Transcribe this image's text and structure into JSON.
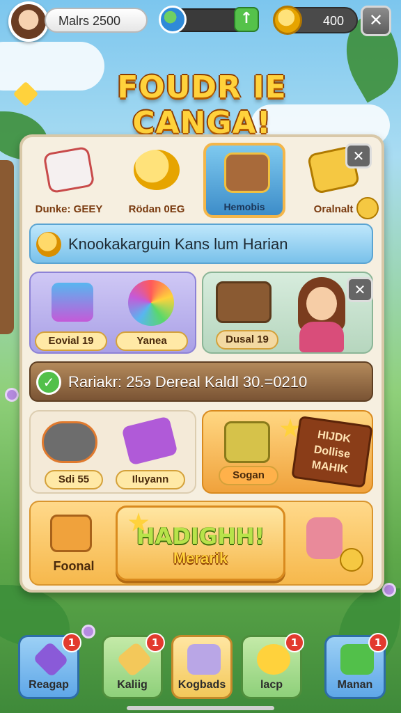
{
  "header": {
    "player_name": "Malrs 2500",
    "coins": "400",
    "title": "FOUDR IE CANGA!"
  },
  "categories": [
    {
      "label": "Dunke: GEEY",
      "icon": "card-icon"
    },
    {
      "label": "Rödan 0EG",
      "icon": "coin-bag-icon"
    },
    {
      "label": "Hemobis",
      "icon": "chest-icon",
      "selected": true
    },
    {
      "label": "Oralnalt",
      "icon": "ticket-icon"
    }
  ],
  "info_banner": "Knookakarguin Kans lum Harian",
  "items_row1": {
    "tag_left": "Eovial 19",
    "tag_right": "Yanea",
    "chest_tag": "Dusal 19"
  },
  "status_banner": "Rariakr: 25э Dereal Kaldl 30.=0210",
  "items_row2": {
    "tag_left": "Sdi 55",
    "tag_right": "Iluyann",
    "shop_tag": "Sogan",
    "sign_lines": [
      "HIJDK",
      "Dollise",
      "MAHIK"
    ]
  },
  "featured": {
    "left_label": "Foonal",
    "button_line1": "HADIGHH!",
    "button_line2": "Merarik"
  },
  "nav": [
    {
      "label": "Reagap",
      "badge": "1",
      "color": "#5fa7e8"
    },
    {
      "label": "Kaliig",
      "badge": "1",
      "color": "#8ed07a"
    },
    {
      "label": "Kogbads",
      "badge": "",
      "color": "#f3c85a"
    },
    {
      "label": "lacp",
      "badge": "1",
      "color": "#8ed07a"
    },
    {
      "label": "Manan",
      "badge": "1",
      "color": "#5fa7e8"
    }
  ],
  "colors": {
    "accent_gold": "#ffd23c",
    "selected_blue": "#3d8dc9",
    "panel": "#f6efe0"
  }
}
